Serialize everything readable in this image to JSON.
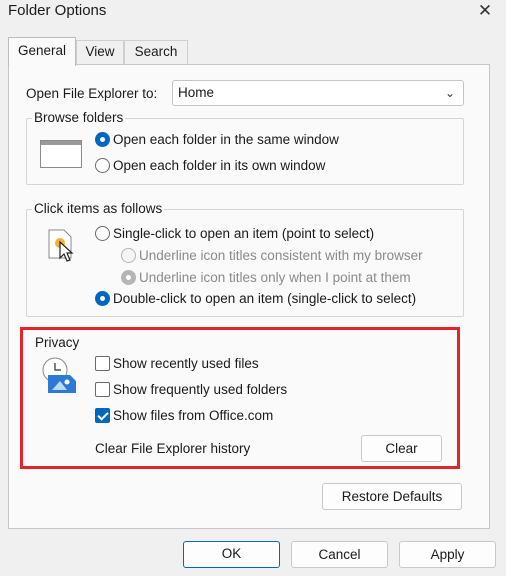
{
  "window": {
    "title": "Folder Options",
    "close_glyph": "✕"
  },
  "tabs": [
    {
      "label": "General",
      "active": true
    },
    {
      "label": "View",
      "active": false
    },
    {
      "label": "Search",
      "active": false
    }
  ],
  "open_to": {
    "label": "Open File Explorer to:",
    "value": "Home",
    "chevron": "⌄"
  },
  "browse_folders": {
    "title": "Browse folders",
    "options": [
      {
        "label": "Open each folder in the same window",
        "selected": true
      },
      {
        "label": "Open each folder in its own window",
        "selected": false
      }
    ]
  },
  "click_items": {
    "title": "Click items as follows",
    "single_click": {
      "label": "Single-click to open an item (point to select)",
      "selected": false
    },
    "underline_browser": {
      "label": "Underline icon titles consistent with my browser",
      "selected": false
    },
    "underline_point": {
      "label": "Underline icon titles only when I point at them",
      "selected": true
    },
    "double_click": {
      "label": "Double-click to open an item (single-click to select)",
      "selected": true
    }
  },
  "privacy": {
    "title": "Privacy",
    "options": [
      {
        "label": "Show recently used files",
        "checked": false
      },
      {
        "label": "Show frequently used folders",
        "checked": false
      },
      {
        "label": "Show files from Office.com",
        "checked": true
      }
    ],
    "clear_history_label": "Clear File Explorer history",
    "clear_button": "Clear",
    "highlight_color": "#e1252a"
  },
  "restore_defaults": "Restore Defaults",
  "footer": {
    "ok": "OK",
    "cancel": "Cancel",
    "apply": "Apply"
  },
  "colors": {
    "accent": "#0067c0",
    "panel": "#fafafa",
    "window": "#f0f0f0"
  }
}
